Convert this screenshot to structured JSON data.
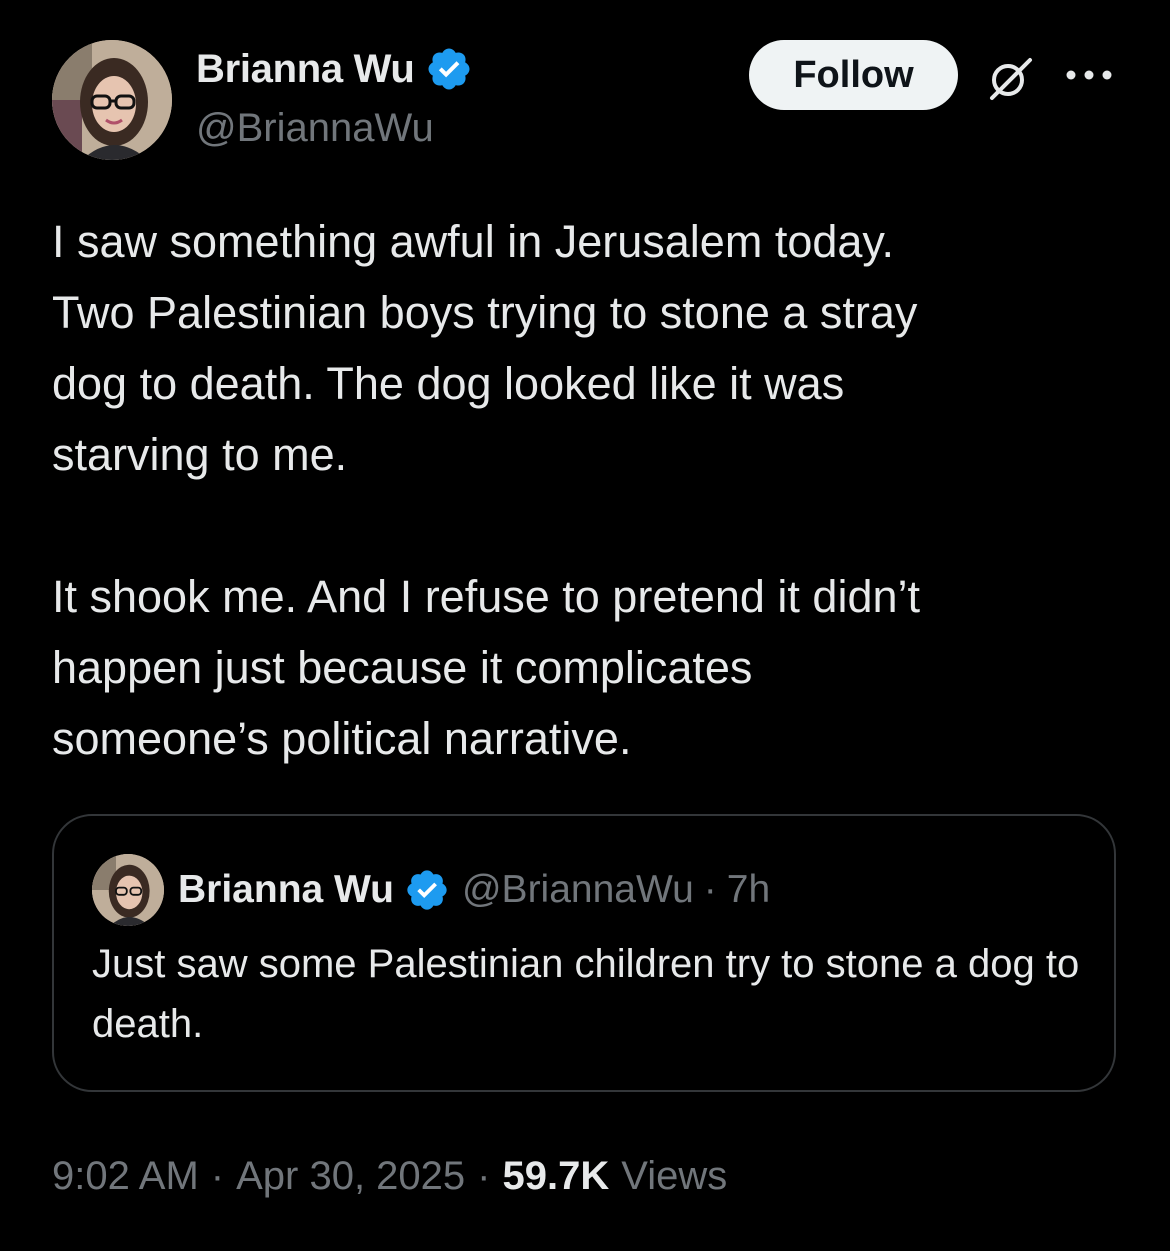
{
  "author": {
    "display_name": "Brianna Wu",
    "handle": "@BriannaWu",
    "verified_color": "#1d9bf0"
  },
  "actions": {
    "follow_label": "Follow",
    "grok_icon": "grok-icon",
    "more_icon": "more-icon"
  },
  "body": {
    "text": "I saw something awful in Jerusalem today.\nTwo Palestinian boys trying to stone a stray\ndog to death. The dog looked like it was\nstarving to me.\n\nIt shook me. And I refuse to pretend it didn’t\nhappen just because it complicates\nsomeone’s political narrative."
  },
  "quoted_tweet": {
    "display_name": "Brianna Wu",
    "handle": "@BriannaWu",
    "separator": "·",
    "age": "7h",
    "text": "Just saw some Palestinian children try to stone a dog to death."
  },
  "meta": {
    "time": "9:02 AM",
    "separator": "·",
    "date": "Apr 30, 2025",
    "views_count": "59.7K",
    "views_label": "Views"
  }
}
